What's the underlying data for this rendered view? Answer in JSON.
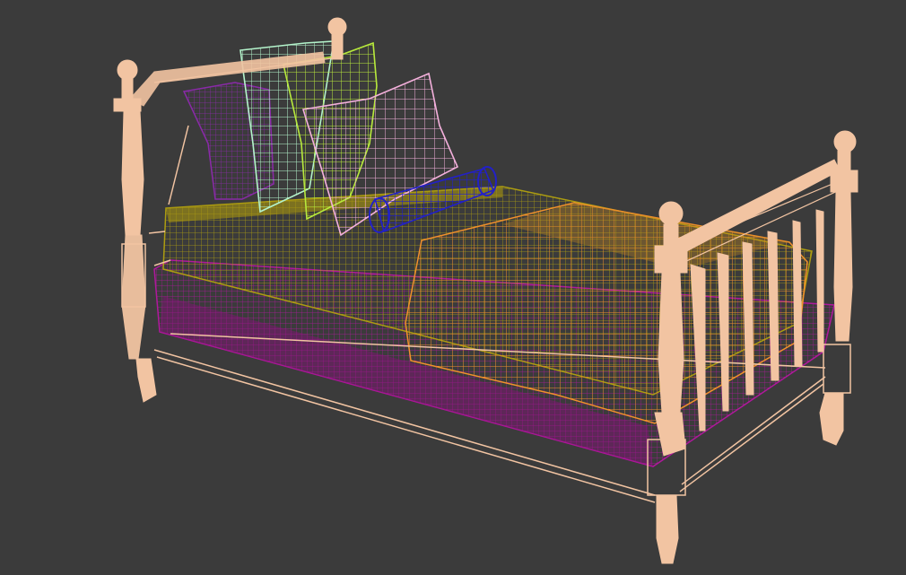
{
  "viewport": {
    "background": "#3b3b3b"
  },
  "scene": {
    "model": "bed",
    "render_mode": "wireframe",
    "objects": [
      {
        "name": "bed-frame-posts",
        "color": "#f2c4a2"
      },
      {
        "name": "mattress-base",
        "color": "#a3108f"
      },
      {
        "name": "mattress-top",
        "color": "#a8960f"
      },
      {
        "name": "blanket",
        "color": "#f08c2a"
      },
      {
        "name": "pillow-purple",
        "color": "#7a1c9a"
      },
      {
        "name": "pillow-mint",
        "color": "#aef0c8"
      },
      {
        "name": "pillow-lime",
        "color": "#b5e63a"
      },
      {
        "name": "pillow-pink",
        "color": "#f2a8d8"
      },
      {
        "name": "bolster",
        "color": "#1c1ab4"
      }
    ]
  }
}
